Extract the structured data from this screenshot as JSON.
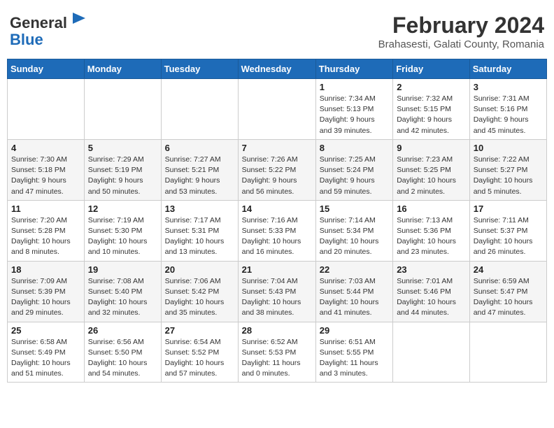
{
  "logo": {
    "general": "General",
    "blue": "Blue"
  },
  "title": "February 2024",
  "subtitle": "Brahasesti, Galati County, Romania",
  "days_header": [
    "Sunday",
    "Monday",
    "Tuesday",
    "Wednesday",
    "Thursday",
    "Friday",
    "Saturday"
  ],
  "weeks": [
    [
      {
        "day": "",
        "info": ""
      },
      {
        "day": "",
        "info": ""
      },
      {
        "day": "",
        "info": ""
      },
      {
        "day": "",
        "info": ""
      },
      {
        "day": "1",
        "info": "Sunrise: 7:34 AM\nSunset: 5:13 PM\nDaylight: 9 hours\nand 39 minutes."
      },
      {
        "day": "2",
        "info": "Sunrise: 7:32 AM\nSunset: 5:15 PM\nDaylight: 9 hours\nand 42 minutes."
      },
      {
        "day": "3",
        "info": "Sunrise: 7:31 AM\nSunset: 5:16 PM\nDaylight: 9 hours\nand 45 minutes."
      }
    ],
    [
      {
        "day": "4",
        "info": "Sunrise: 7:30 AM\nSunset: 5:18 PM\nDaylight: 9 hours\nand 47 minutes."
      },
      {
        "day": "5",
        "info": "Sunrise: 7:29 AM\nSunset: 5:19 PM\nDaylight: 9 hours\nand 50 minutes."
      },
      {
        "day": "6",
        "info": "Sunrise: 7:27 AM\nSunset: 5:21 PM\nDaylight: 9 hours\nand 53 minutes."
      },
      {
        "day": "7",
        "info": "Sunrise: 7:26 AM\nSunset: 5:22 PM\nDaylight: 9 hours\nand 56 minutes."
      },
      {
        "day": "8",
        "info": "Sunrise: 7:25 AM\nSunset: 5:24 PM\nDaylight: 9 hours\nand 59 minutes."
      },
      {
        "day": "9",
        "info": "Sunrise: 7:23 AM\nSunset: 5:25 PM\nDaylight: 10 hours\nand 2 minutes."
      },
      {
        "day": "10",
        "info": "Sunrise: 7:22 AM\nSunset: 5:27 PM\nDaylight: 10 hours\nand 5 minutes."
      }
    ],
    [
      {
        "day": "11",
        "info": "Sunrise: 7:20 AM\nSunset: 5:28 PM\nDaylight: 10 hours\nand 8 minutes."
      },
      {
        "day": "12",
        "info": "Sunrise: 7:19 AM\nSunset: 5:30 PM\nDaylight: 10 hours\nand 10 minutes."
      },
      {
        "day": "13",
        "info": "Sunrise: 7:17 AM\nSunset: 5:31 PM\nDaylight: 10 hours\nand 13 minutes."
      },
      {
        "day": "14",
        "info": "Sunrise: 7:16 AM\nSunset: 5:33 PM\nDaylight: 10 hours\nand 16 minutes."
      },
      {
        "day": "15",
        "info": "Sunrise: 7:14 AM\nSunset: 5:34 PM\nDaylight: 10 hours\nand 20 minutes."
      },
      {
        "day": "16",
        "info": "Sunrise: 7:13 AM\nSunset: 5:36 PM\nDaylight: 10 hours\nand 23 minutes."
      },
      {
        "day": "17",
        "info": "Sunrise: 7:11 AM\nSunset: 5:37 PM\nDaylight: 10 hours\nand 26 minutes."
      }
    ],
    [
      {
        "day": "18",
        "info": "Sunrise: 7:09 AM\nSunset: 5:39 PM\nDaylight: 10 hours\nand 29 minutes."
      },
      {
        "day": "19",
        "info": "Sunrise: 7:08 AM\nSunset: 5:40 PM\nDaylight: 10 hours\nand 32 minutes."
      },
      {
        "day": "20",
        "info": "Sunrise: 7:06 AM\nSunset: 5:42 PM\nDaylight: 10 hours\nand 35 minutes."
      },
      {
        "day": "21",
        "info": "Sunrise: 7:04 AM\nSunset: 5:43 PM\nDaylight: 10 hours\nand 38 minutes."
      },
      {
        "day": "22",
        "info": "Sunrise: 7:03 AM\nSunset: 5:44 PM\nDaylight: 10 hours\nand 41 minutes."
      },
      {
        "day": "23",
        "info": "Sunrise: 7:01 AM\nSunset: 5:46 PM\nDaylight: 10 hours\nand 44 minutes."
      },
      {
        "day": "24",
        "info": "Sunrise: 6:59 AM\nSunset: 5:47 PM\nDaylight: 10 hours\nand 47 minutes."
      }
    ],
    [
      {
        "day": "25",
        "info": "Sunrise: 6:58 AM\nSunset: 5:49 PM\nDaylight: 10 hours\nand 51 minutes."
      },
      {
        "day": "26",
        "info": "Sunrise: 6:56 AM\nSunset: 5:50 PM\nDaylight: 10 hours\nand 54 minutes."
      },
      {
        "day": "27",
        "info": "Sunrise: 6:54 AM\nSunset: 5:52 PM\nDaylight: 10 hours\nand 57 minutes."
      },
      {
        "day": "28",
        "info": "Sunrise: 6:52 AM\nSunset: 5:53 PM\nDaylight: 11 hours\nand 0 minutes."
      },
      {
        "day": "29",
        "info": "Sunrise: 6:51 AM\nSunset: 5:55 PM\nDaylight: 11 hours\nand 3 minutes."
      },
      {
        "day": "",
        "info": ""
      },
      {
        "day": "",
        "info": ""
      }
    ]
  ]
}
